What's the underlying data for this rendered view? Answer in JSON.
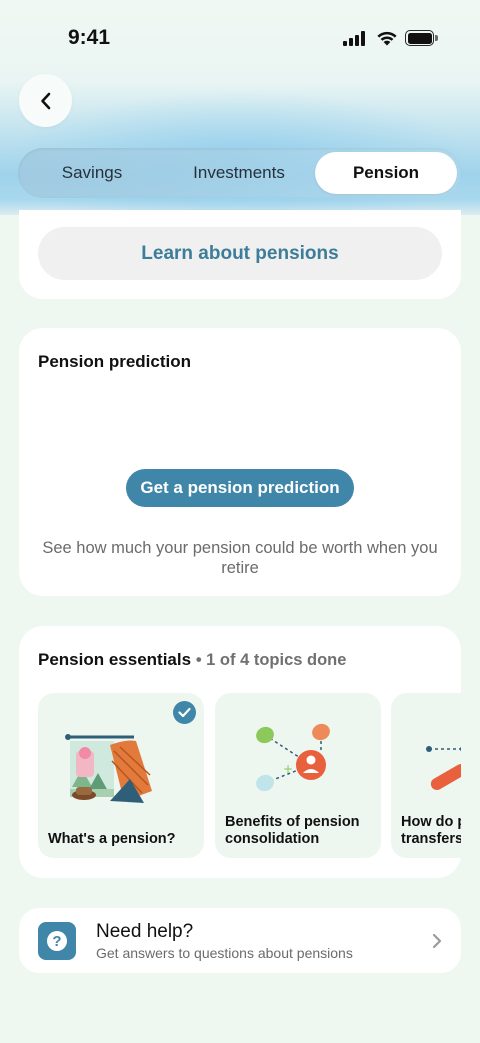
{
  "status_bar": {
    "time": "9:41"
  },
  "tabs": [
    {
      "label": "Savings",
      "active": false
    },
    {
      "label": "Investments",
      "active": false
    },
    {
      "label": "Pension",
      "active": true
    }
  ],
  "learn": {
    "button_label": "Learn about pensions"
  },
  "prediction": {
    "title": "Pension prediction",
    "button_label": "Get a pension prediction",
    "description": "See how much your pension could be worth when you retire"
  },
  "essentials": {
    "title": "Pension essentials",
    "progress": "• 1 of 4 topics done",
    "topics": [
      {
        "label": "What's a pension?",
        "done": true
      },
      {
        "label_line1": "Benefits of pension",
        "label_line2": "consolidation",
        "done": false
      },
      {
        "label_line1": "How do pension",
        "label_line2": "transfers work?",
        "done": false
      }
    ]
  },
  "help": {
    "title": "Need help?",
    "subtitle": "Get answers to questions about pensions"
  },
  "colors": {
    "accent": "#3f86a8",
    "background": "#eff7f1",
    "card": "#ffffff"
  }
}
